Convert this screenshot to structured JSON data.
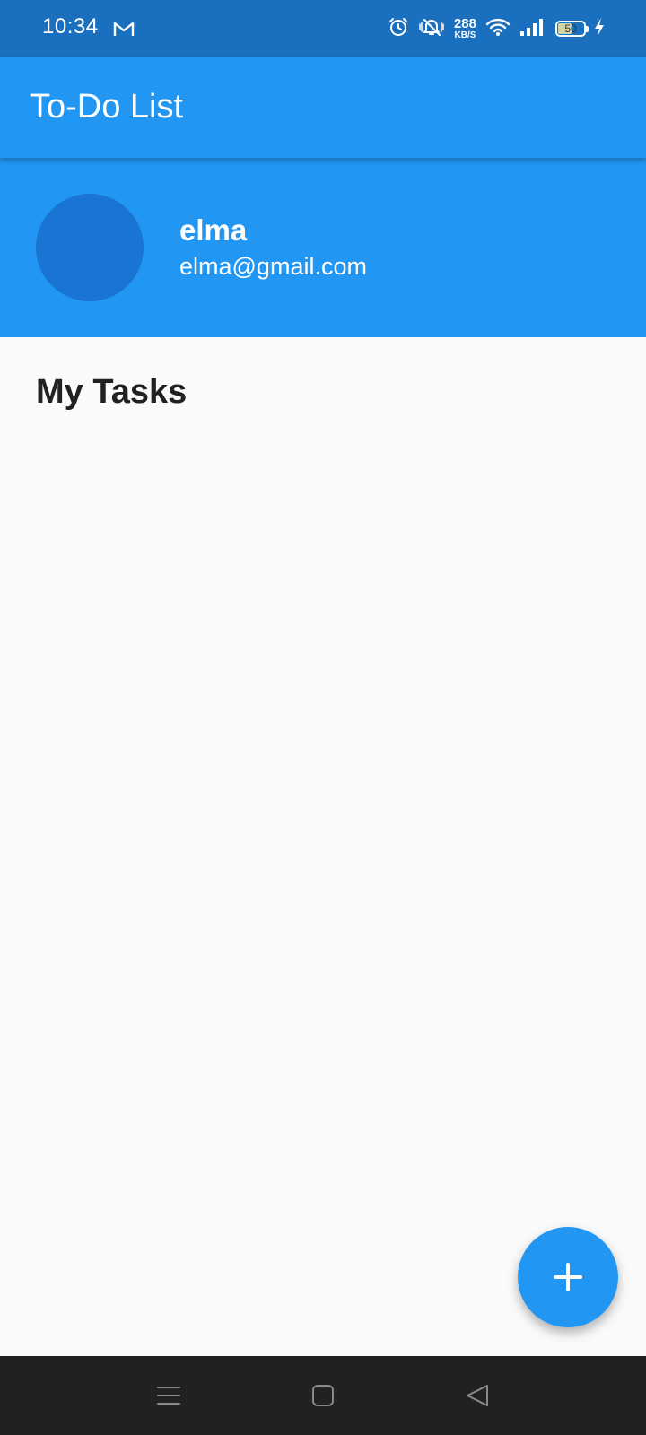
{
  "status_bar": {
    "time": "10:34",
    "net_speed_value": "288",
    "net_speed_unit": "KB/S",
    "battery_level": "50",
    "icons": [
      "gmail-icon",
      "alarm-icon",
      "vibrate-off-icon",
      "wifi-icon",
      "signal-icon",
      "battery-icon",
      "charging-icon"
    ],
    "background": "#1b6fbf"
  },
  "app_bar": {
    "title": "To-Do List",
    "color": "#2196f3"
  },
  "profile": {
    "name": "elma",
    "email": "elma@gmail.com",
    "avatar_color": "#1a74d4"
  },
  "main": {
    "section_title": "My Tasks",
    "tasks": []
  },
  "fab": {
    "icon": "add-icon"
  },
  "nav_bar": {
    "buttons": [
      "menu-icon",
      "home-icon",
      "back-icon"
    ]
  }
}
